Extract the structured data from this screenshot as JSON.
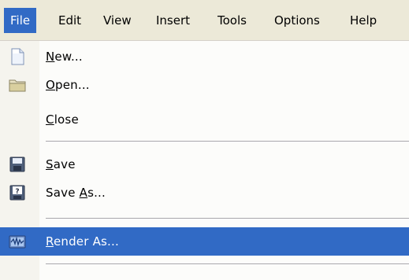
{
  "menubar": {
    "items": [
      {
        "label": "File",
        "active": true
      },
      {
        "label": "Edit"
      },
      {
        "label": "View"
      },
      {
        "label": "Insert"
      },
      {
        "label": "Tools"
      },
      {
        "label": "Options"
      },
      {
        "label": "Help"
      }
    ]
  },
  "file_menu": {
    "items": [
      {
        "pre": "",
        "key": "N",
        "post": "ew...",
        "icon": "new-document-icon"
      },
      {
        "pre": "",
        "key": "O",
        "post": "pen...",
        "icon": "folder-icon"
      },
      {
        "pre": "",
        "key": "C",
        "post": "lose",
        "icon": null
      },
      {
        "pre": "",
        "key": "S",
        "post": "ave",
        "icon": "floppy-disk-icon"
      },
      {
        "pre": "Save ",
        "key": "A",
        "post": "s...",
        "icon": "save-as-icon"
      },
      {
        "pre": "",
        "key": "R",
        "post": "ender As...",
        "icon": "render-icon",
        "highlighted": true
      }
    ]
  },
  "colors": {
    "highlight": "#316ac5",
    "menubar_bg": "#ece9d8",
    "menu_bg": "#fcfcfa"
  }
}
